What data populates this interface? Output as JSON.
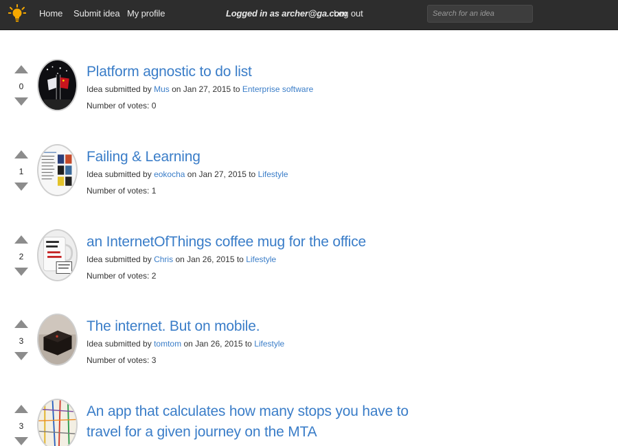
{
  "nav": {
    "logo_icon": "lightbulb-icon",
    "home": "Home",
    "submit": "Submit idea",
    "profile": "My profile",
    "logged_in": "Logged in as archer@ga.com",
    "logout": "Log out",
    "search_placeholder": "Search for an idea"
  },
  "ideas": [
    {
      "votes": "0",
      "title": "Platform agnostic to do list",
      "prefix": "Idea submitted by",
      "author": "Mus",
      "date_text": "on Jan 27, 2015 to",
      "category": "Enterprise software",
      "votes_label": "Number of votes: 0"
    },
    {
      "votes": "1",
      "title": "Failing & Learning",
      "prefix": "Idea submitted by",
      "author": "eokocha",
      "date_text": "on Jan 27, 2015 to",
      "category": "Lifestyle",
      "votes_label": "Number of votes: 1"
    },
    {
      "votes": "2",
      "title": "an InternetOfThings coffee mug for the office",
      "prefix": "Idea submitted by",
      "author": "Chris",
      "date_text": "on Jan 26, 2015 to",
      "category": "Lifestyle",
      "votes_label": "Number of votes: 2"
    },
    {
      "votes": "3",
      "title": "The internet. But on mobile.",
      "prefix": "Idea submitted by",
      "author": "tomtom",
      "date_text": "on Jan 26, 2015 to",
      "category": "Lifestyle",
      "votes_label": "Number of votes: 3"
    },
    {
      "votes": "3",
      "title": "An app that calculates how many stops you have to travel for a given journey on the MTA"
    }
  ],
  "colors": {
    "navbar": "#2d2d2d",
    "link": "#3a7dc8",
    "arrow": "#8c8c8c",
    "logo": "#f5a800"
  }
}
